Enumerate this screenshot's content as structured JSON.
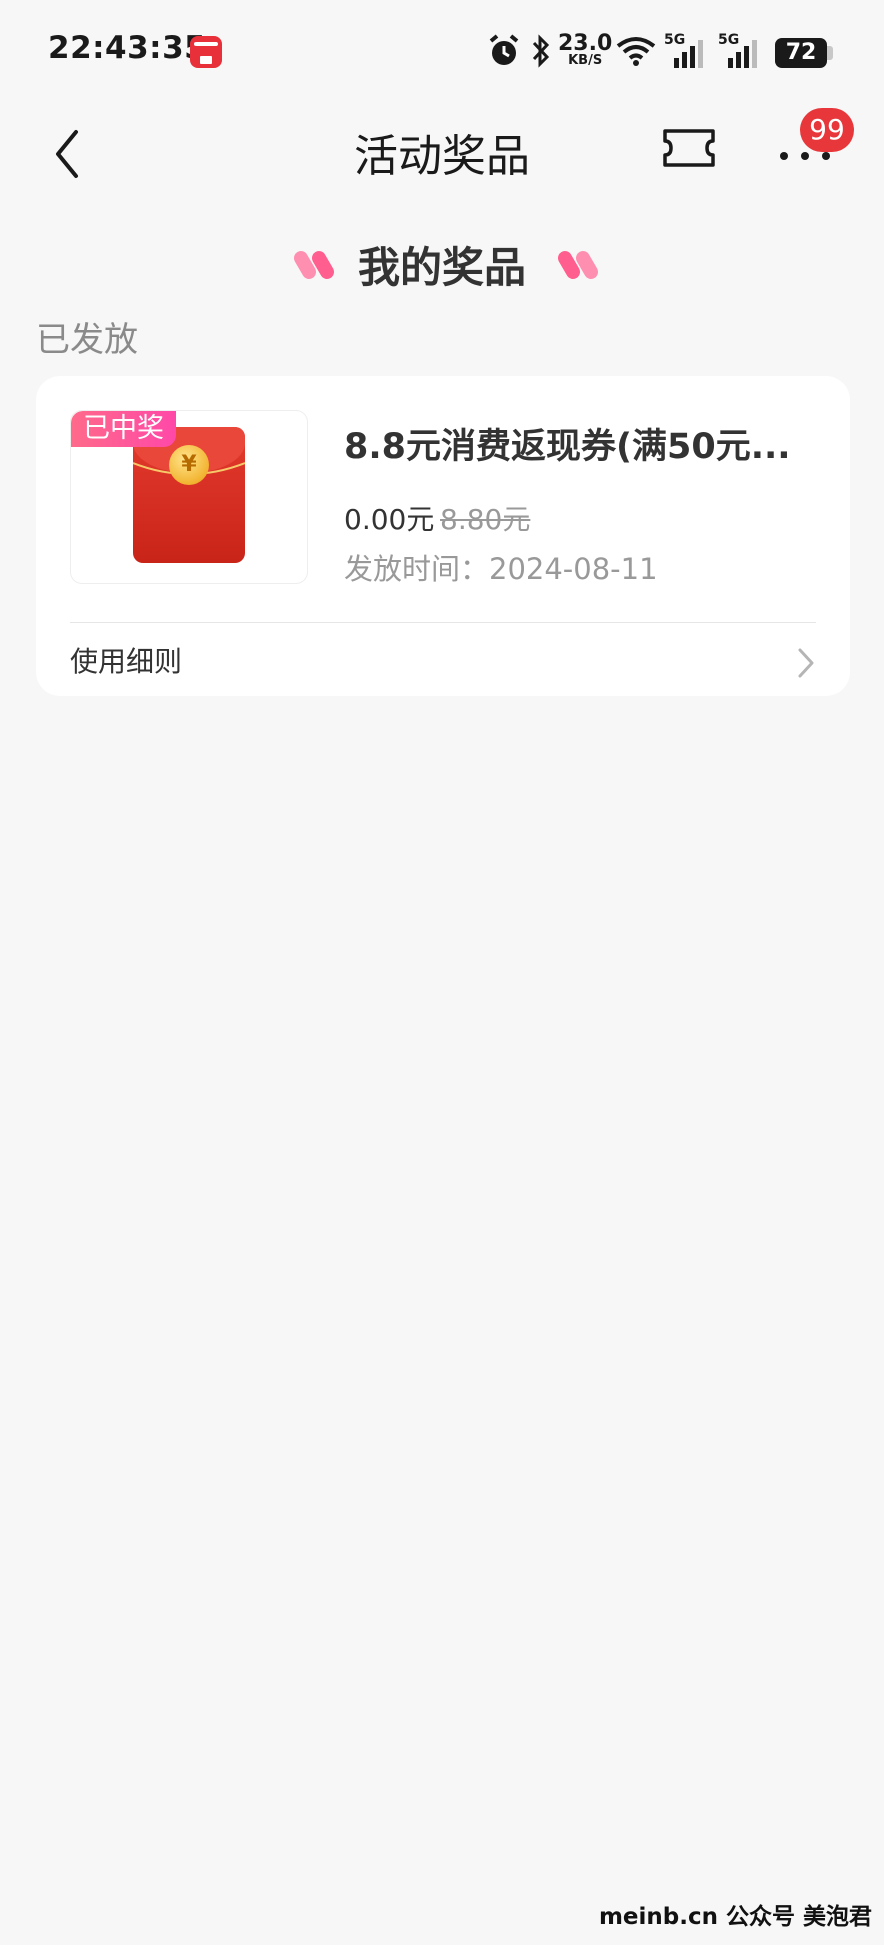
{
  "status_bar": {
    "time": "22:43:35",
    "net_speed_value": "23.0",
    "net_speed_unit": "KB/S",
    "signal_1": "5G",
    "signal_2": "5G",
    "battery": "72"
  },
  "nav": {
    "title": "活动奖品",
    "badge_count": "99",
    "icons": [
      "back-icon",
      "ticket-icon",
      "more-icon"
    ]
  },
  "section": {
    "title": "我的奖品",
    "status_label": "已发放"
  },
  "prize": {
    "tag": "已中奖",
    "title": "8.8元消费返现券(满50元...",
    "price": "0.00元",
    "original_price": "8.80元",
    "issue_time": "发放时间：2024-08-11",
    "coin_symbol": "¥",
    "rules_label": "使用细则"
  },
  "colors": {
    "accent_red": "#e8373a",
    "tag_pink": "#ff48a8",
    "background": "#f7f7f7"
  },
  "watermark": "meinb.cn 公众号 美泡君"
}
